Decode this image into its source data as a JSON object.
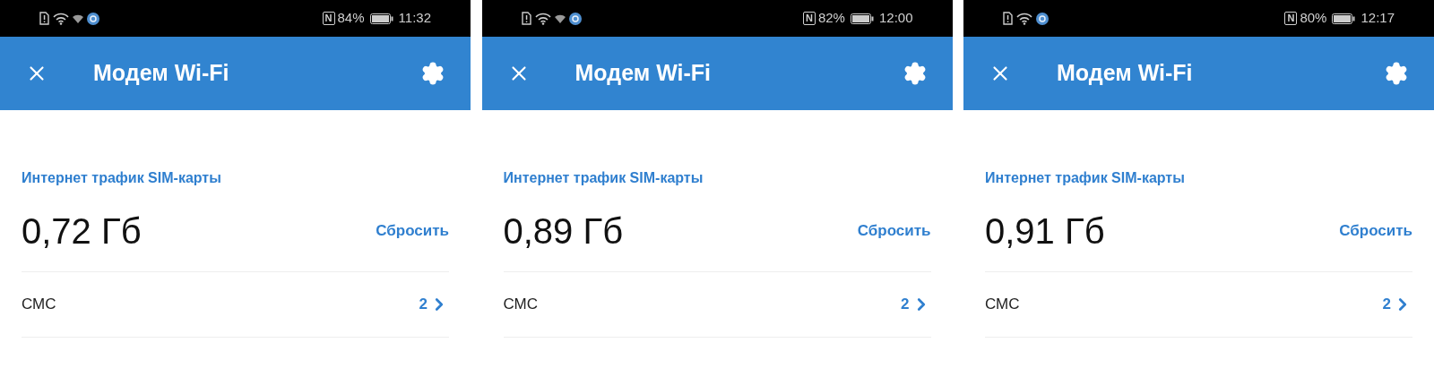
{
  "screens": [
    {
      "status_bar": {
        "icons": [
          {
            "kind": "sim-alert"
          },
          {
            "kind": "wifi"
          },
          {
            "kind": "wifi-small"
          },
          {
            "kind": "app"
          }
        ],
        "nfc": "N",
        "battery": "84%",
        "time": "11:32"
      },
      "header": {
        "title": "Модем Wi-Fi"
      },
      "traffic": {
        "title": "Интернет трафик SIM-карты",
        "value": "0,72 Гб",
        "reset": "Сбросить"
      },
      "sms": {
        "label": "СМС",
        "count": "2"
      }
    },
    {
      "status_bar": {
        "icons": [
          {
            "kind": "sim-alert"
          },
          {
            "kind": "wifi"
          },
          {
            "kind": "wifi-small"
          },
          {
            "kind": "app"
          }
        ],
        "nfc": "N",
        "battery": "82%",
        "time": "12:00"
      },
      "header": {
        "title": "Модем Wi-Fi"
      },
      "traffic": {
        "title": "Интернет трафик SIM-карты",
        "value": "0,89 Гб",
        "reset": "Сбросить"
      },
      "sms": {
        "label": "СМС",
        "count": "2"
      }
    },
    {
      "status_bar": {
        "icons": [
          {
            "kind": "sim-alert"
          },
          {
            "kind": "wifi"
          },
          {
            "kind": "app"
          }
        ],
        "nfc": "N",
        "battery": "80%",
        "time": "12:17"
      },
      "header": {
        "title": "Модем Wi-Fi"
      },
      "traffic": {
        "title": "Интернет трафик SIM-карты",
        "value": "0,91 Гб",
        "reset": "Сбросить"
      },
      "sms": {
        "label": "СМС",
        "count": "2"
      }
    }
  ]
}
